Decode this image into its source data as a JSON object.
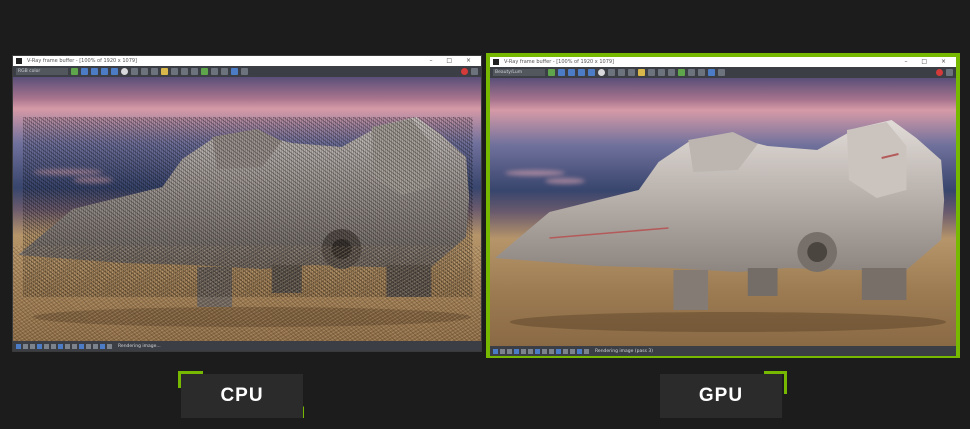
{
  "cpu_panel": {
    "window_title": "V-Ray frame buffer - [100% of 1920 x 1079]",
    "display_mode": "RGB color",
    "status": "Rendering image..."
  },
  "gpu_panel": {
    "window_title": "V-Ray frame buffer - [100% of 1920 x 1079]",
    "display_mode": "Beauty/Lum",
    "status": "Rendering image (pass 3)"
  },
  "window_controls": "– □ ×",
  "labels": {
    "cpu": "CPU",
    "gpu": "GPU"
  },
  "colors": {
    "accent": "#76b900",
    "background": "#1c1c1c",
    "label_box": "#2b2b2b"
  },
  "icons": [
    "app-icon",
    "close-icon",
    "minimize-icon",
    "maximize-icon",
    "record-icon"
  ]
}
